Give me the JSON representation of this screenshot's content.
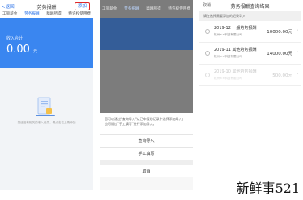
{
  "phone1": {
    "back_label": "<返回",
    "title": "劳务报酬",
    "add_label": "添加",
    "tabs": [
      "工资薪金",
      "劳务报酬",
      "稿酬所得",
      "特许权使用费"
    ],
    "active_tab": 1,
    "card": {
      "label": "收入合计",
      "value": "0.00",
      "unit": "元"
    },
    "empty_text": "您还没有相关的收入记录，请点击右上角添加"
  },
  "phone2": {
    "tabs": [
      "工资薪金",
      "劳务报酬",
      "稿酬所得",
      "特许权使用费"
    ],
    "active_tab": 1,
    "sheet_message": "您可以通过\"查询导入\"从已申报的记录中选择添加导入；也可通过\"手工填写\"进行添加导入。",
    "buttons": {
      "query_import": "查询导入",
      "manual_fill": "手工填写",
      "cancel": "取消"
    }
  },
  "phone3": {
    "back_label": "取消",
    "title": "劳务报酬查询结果",
    "hint": "请在选择需要添加的记录导入",
    "records": [
      {
        "title": "2019-12 一般劳务报酬",
        "subtitle": "杭州××科技有限公司",
        "amount": "10000.00元",
        "disabled": false
      },
      {
        "title": "2019-11 其他劳务报酬",
        "subtitle": "杭州××科技有限公司",
        "amount": "14000.00元",
        "disabled": false
      },
      {
        "title": "2019-10 其他劳务报酬",
        "subtitle": "杭州××科技有限公司",
        "amount": "500.00元",
        "disabled": true
      }
    ]
  },
  "watermark": "新鲜事521",
  "colors": {
    "accent": "#2a72e8",
    "card_blue": "#3a86f0",
    "overlay_gray": "#7c7c7c",
    "highlight_red": "#e02828"
  }
}
